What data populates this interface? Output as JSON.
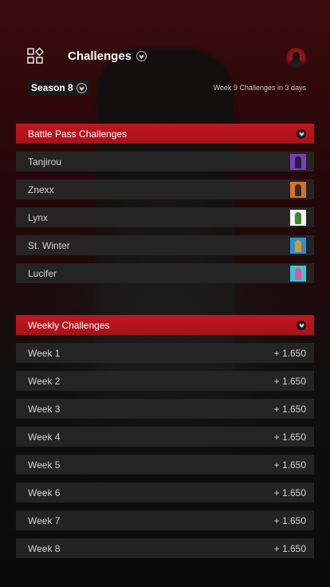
{
  "header": {
    "title": "Challenges"
  },
  "season": {
    "label": "Season 8"
  },
  "notice": "Week 9 Challenges in 3 days",
  "battle_pass": {
    "title": "Battle Pass Challenges",
    "items": [
      {
        "name": "Tanjirou",
        "thumb_bg": "#7a3fb8",
        "thumb_fig": "#2c1a3a"
      },
      {
        "name": "Znexx",
        "thumb_bg": "#d3742a",
        "thumb_fig": "#3a2a2a"
      },
      {
        "name": "Lynx",
        "thumb_bg": "#f4f4f4",
        "thumb_fig": "#3d8a2a"
      },
      {
        "name": "St. Winter",
        "thumb_bg": "#2b8fd6",
        "thumb_fig": "#e0951f"
      },
      {
        "name": "Lucifer",
        "thumb_bg": "#39c4d8",
        "thumb_fig": "#e8519a"
      }
    ]
  },
  "weekly": {
    "title": "Weekly Challenges",
    "items": [
      {
        "name": "Week 1",
        "xp": "+ 1.650"
      },
      {
        "name": "Week 2",
        "xp": "+ 1.650"
      },
      {
        "name": "Week 3",
        "xp": "+ 1.650"
      },
      {
        "name": "Week 4",
        "xp": "+ 1.650"
      },
      {
        "name": "Week 5",
        "xp": "+ 1.650"
      },
      {
        "name": "Week 6",
        "xp": "+ 1.650"
      },
      {
        "name": "Week 7",
        "xp": "+ 1.650"
      },
      {
        "name": "Week 8",
        "xp": "+ 1.650"
      }
    ]
  },
  "colors": {
    "accent": "#c0161f",
    "row_bg": "#262626"
  }
}
